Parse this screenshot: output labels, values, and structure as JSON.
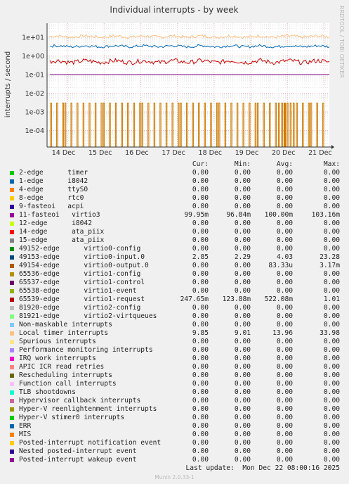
{
  "chart_data": {
    "type": "line",
    "title": "Individual interrupts - by week",
    "ylabel": "interrupts / second",
    "y_scale": "log",
    "ylim": [
      1e-05,
      50
    ],
    "y_ticks": [
      "1e+01",
      "1e+00",
      "1e-01",
      "1e-02",
      "1e-03",
      "1e-04"
    ],
    "x_ticks": [
      "14 Dec",
      "15 Dec",
      "16 Dec",
      "17 Dec",
      "18 Dec",
      "19 Dec",
      "20 Dec",
      "21 Dec"
    ],
    "grid": true,
    "series": [
      {
        "name": "Local timer interrupts",
        "approx_level": 13.96,
        "color": "#ffc080"
      },
      {
        "name": "49153-edge virtio0-input.0",
        "approx_level": 4.03,
        "color": "#0066b3"
      },
      {
        "name": "65539-edge virtio1-request",
        "approx_level": 0.522,
        "color": "#cc0000"
      },
      {
        "name": "11-fasteoi virtio3",
        "approx_level": 0.1,
        "color": "#800080"
      },
      {
        "name": "49154-edge virtio0-output.0",
        "approx_level": 8.33e-05,
        "color": "#cc7a00",
        "note": "periodic spikes to ~3e-3"
      }
    ]
  },
  "side_label": "RRDTOOL / TOBI OETIKER",
  "legend": {
    "headers": {
      "cur": "Cur:",
      "min": "Min:",
      "avg": "Avg:",
      "max": "Max:"
    },
    "rows": [
      {
        "color": "#00cc00",
        "name": "2-edge      timer",
        "cur": "0.00",
        "min": "0.00",
        "avg": "0.00",
        "max": "0.00"
      },
      {
        "color": "#0066b3",
        "name": "1-edge      i8042",
        "cur": "0.00",
        "min": "0.00",
        "avg": "0.00",
        "max": "0.00"
      },
      {
        "color": "#ff8000",
        "name": "4-edge      ttyS0",
        "cur": "0.00",
        "min": "0.00",
        "avg": "0.00",
        "max": "0.00"
      },
      {
        "color": "#ffcc00",
        "name": "8-edge      rtc0",
        "cur": "0.00",
        "min": "0.00",
        "avg": "0.00",
        "max": "0.00"
      },
      {
        "color": "#330099",
        "name": "9-fasteoi   acpi",
        "cur": "0.00",
        "min": "0.00",
        "avg": "0.00",
        "max": "0.00"
      },
      {
        "color": "#990099",
        "name": "11-fasteoi   virtio3",
        "cur": "99.95m",
        "min": "96.84m",
        "avg": "100.00m",
        "max": "103.16m"
      },
      {
        "color": "#ccff00",
        "name": "12-edge      i8042",
        "cur": "0.00",
        "min": "0.00",
        "avg": "0.00",
        "max": "0.00"
      },
      {
        "color": "#ff0000",
        "name": "14-edge      ata_piix",
        "cur": "0.00",
        "min": "0.00",
        "avg": "0.00",
        "max": "0.00"
      },
      {
        "color": "#808080",
        "name": "15-edge      ata_piix",
        "cur": "0.00",
        "min": "0.00",
        "avg": "0.00",
        "max": "0.00"
      },
      {
        "color": "#008f00",
        "name": "49152-edge      virtio0-config",
        "cur": "0.00",
        "min": "0.00",
        "avg": "0.00",
        "max": "0.00"
      },
      {
        "color": "#00487d",
        "name": "49153-edge      virtio0-input.0",
        "cur": "2.85",
        "min": "2.29",
        "avg": "4.03",
        "max": "23.28"
      },
      {
        "color": "#b35a00",
        "name": "49154-edge      virtio0-output.0",
        "cur": "0.00",
        "min": "0.00",
        "avg": "83.33u",
        "max": "3.17m"
      },
      {
        "color": "#b38f00",
        "name": "65536-edge      virtio1-config",
        "cur": "0.00",
        "min": "0.00",
        "avg": "0.00",
        "max": "0.00"
      },
      {
        "color": "#6b006b",
        "name": "65537-edge      virtio1-control",
        "cur": "0.00",
        "min": "0.00",
        "avg": "0.00",
        "max": "0.00"
      },
      {
        "color": "#8fb300",
        "name": "65538-edge      virtio1-event",
        "cur": "0.00",
        "min": "0.00",
        "avg": "0.00",
        "max": "0.00"
      },
      {
        "color": "#b30000",
        "name": "65539-edge      virtio1-request",
        "cur": "247.65m",
        "min": "123.88m",
        "avg": "522.08m",
        "max": "1.01"
      },
      {
        "color": "#bebebe",
        "name": "81920-edge      virtio2-config",
        "cur": "0.00",
        "min": "0.00",
        "avg": "0.00",
        "max": "0.00"
      },
      {
        "color": "#80ff80",
        "name": "81921-edge      virtio2-virtqueues",
        "cur": "0.00",
        "min": "0.00",
        "avg": "0.00",
        "max": "0.00"
      },
      {
        "color": "#80c9ff",
        "name": "Non-maskable interrupts",
        "cur": "0.00",
        "min": "0.00",
        "avg": "0.00",
        "max": "0.00"
      },
      {
        "color": "#ffc080",
        "name": "Local timer interrupts",
        "cur": "9.85",
        "min": "9.01",
        "avg": "13.96",
        "max": "33.98"
      },
      {
        "color": "#ffe680",
        "name": "Spurious interrupts",
        "cur": "0.00",
        "min": "0.00",
        "avg": "0.00",
        "max": "0.00"
      },
      {
        "color": "#aa80ff",
        "name": "Performance monitoring interrupts",
        "cur": "0.00",
        "min": "0.00",
        "avg": "0.00",
        "max": "0.00"
      },
      {
        "color": "#ee00cc",
        "name": "IRQ work interrupts",
        "cur": "0.00",
        "min": "0.00",
        "avg": "0.00",
        "max": "0.00"
      },
      {
        "color": "#ff8080",
        "name": "APIC ICR read retries",
        "cur": "0.00",
        "min": "0.00",
        "avg": "0.00",
        "max": "0.00"
      },
      {
        "color": "#666600",
        "name": "Rescheduling interrupts",
        "cur": "0.00",
        "min": "0.00",
        "avg": "0.00",
        "max": "0.00"
      },
      {
        "color": "#ffbfff",
        "name": "Function call interrupts",
        "cur": "0.00",
        "min": "0.00",
        "avg": "0.00",
        "max": "0.00"
      },
      {
        "color": "#00ffcc",
        "name": "TLB shootdowns",
        "cur": "0.00",
        "min": "0.00",
        "avg": "0.00",
        "max": "0.00"
      },
      {
        "color": "#cc6699",
        "name": "Hypervisor callback interrupts",
        "cur": "0.00",
        "min": "0.00",
        "avg": "0.00",
        "max": "0.00"
      },
      {
        "color": "#999900",
        "name": "Hyper-V reenlightenment interrupts",
        "cur": "0.00",
        "min": "0.00",
        "avg": "0.00",
        "max": "0.00"
      },
      {
        "color": "#00cc00",
        "name": "Hyper-V stimer0 interrupts",
        "cur": "0.00",
        "min": "0.00",
        "avg": "0.00",
        "max": "0.00"
      },
      {
        "color": "#0066b3",
        "name": "ERR",
        "cur": "0.00",
        "min": "0.00",
        "avg": "0.00",
        "max": "0.00"
      },
      {
        "color": "#ff8000",
        "name": "MIS",
        "cur": "0.00",
        "min": "0.00",
        "avg": "0.00",
        "max": "0.00"
      },
      {
        "color": "#ffcc00",
        "name": "Posted-interrupt notification event",
        "cur": "0.00",
        "min": "0.00",
        "avg": "0.00",
        "max": "0.00"
      },
      {
        "color": "#330099",
        "name": "Nested posted-interrupt event",
        "cur": "0.00",
        "min": "0.00",
        "avg": "0.00",
        "max": "0.00"
      },
      {
        "color": "#990099",
        "name": "Posted-interrupt wakeup event",
        "cur": "0.00",
        "min": "0.00",
        "avg": "0.00",
        "max": "0.00"
      }
    ]
  },
  "footer": {
    "last_update": "Last update:  Mon Dec 22 08:00:16 2025",
    "munin": "Munin 2.0.33-1"
  }
}
